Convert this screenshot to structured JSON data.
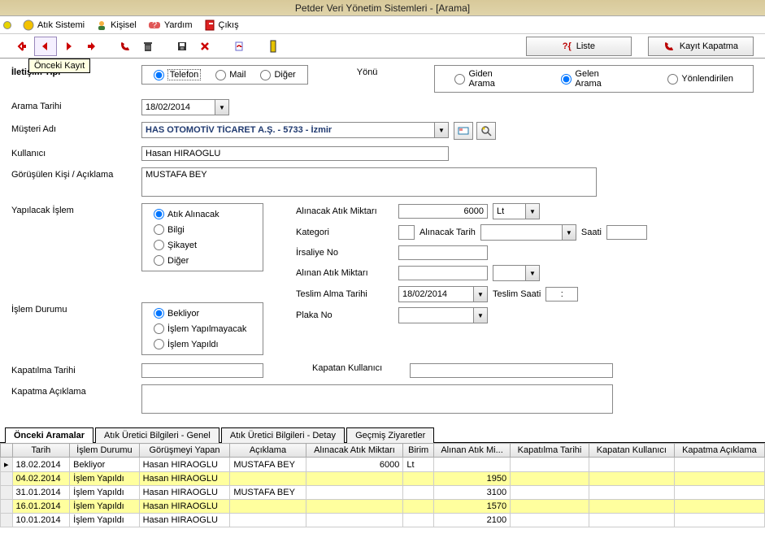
{
  "title": "Petder Veri Yönetim Sistemleri - [Arama]",
  "menu": {
    "atik": "Atık Sistemi",
    "kisisel": "Kişisel",
    "yardim": "Yardım",
    "cikis": "Çıkış"
  },
  "toolbar": {
    "tooltip_prev": "Önceki Kayıt",
    "btn_liste": "Liste",
    "btn_kapat": "Kayıt Kapatma"
  },
  "labels": {
    "iletisim_tipi": "İletişim Tipi",
    "yonu": "Yönü",
    "arama_tarihi": "Arama Tarihi",
    "musteri_adi": "Müşteri Adı",
    "kullanici": "Kullanıcı",
    "gorusulen": "Görüşülen Kişi  /  Açıklama",
    "yapilacak_islem": "Yapılacak İşlem",
    "islem_durumu": "İşlem Durumu",
    "kapatilma_tarihi": "Kapatılma Tarihi",
    "kapatan_kullanici": "Kapatan Kullanıcı",
    "kapatma_aciklama": "Kapatma Açıklama",
    "alinacak_miktar": "Alınacak Atık Miktarı",
    "kategori": "Kategori",
    "alinacak_tarih": "Alınacak Tarih",
    "saati": "Saati",
    "irsaliye": "İrsaliye No",
    "alinan_miktar": "Alınan Atık Miktarı",
    "teslim_tarih": "Teslim Alma Tarihi",
    "teslim_saat": "Teslim Saati",
    "plaka": "Plaka No"
  },
  "iletisim_options": {
    "telefon": "Telefon",
    "mail": "Mail",
    "diger": "Diğer"
  },
  "yonu_options": {
    "giden": "Giden Arama",
    "gelen": "Gelen Arama",
    "yon": "Yönlendirilen"
  },
  "yapilacak_options": {
    "atik": "Atık Alınacak",
    "bilgi": "Bilgi",
    "sikayet": "Şikayet",
    "diger": "Diğer"
  },
  "durum_options": {
    "bekliyor": "Bekliyor",
    "yapilmayacak": "İşlem Yapılmayacak",
    "yapildi": "İşlem Yapıldı"
  },
  "values": {
    "arama_tarihi": "18/02/2014",
    "musteri": "HAS OTOMOTİV TİCARET A.Ş. - 5733 - İzmir",
    "kullanici": "Hasan HIRAOGLU",
    "gorusulen": "MUSTAFA BEY",
    "alinacak_miktar": "6000",
    "birim": "Lt",
    "kategori": "",
    "alinacak_tarih": "",
    "alinacak_saat": "",
    "irsaliye": "",
    "alinan_miktar": "",
    "teslim_tarih": "18/02/2014",
    "teslim_saat": ":",
    "plaka": "",
    "kapatilma_tarihi": "",
    "kapatan_kullanici": "",
    "kapatma_aciklama": ""
  },
  "tabs": {
    "t1": "Önceki Aramalar",
    "t2": "Atık Üretici Bilgileri - Genel",
    "t3": "Atık Üretici Bilgileri - Detay",
    "t4": "Geçmiş Ziyaretler"
  },
  "grid": {
    "headers": {
      "tarih": "Tarih",
      "durum": "İşlem Durumu",
      "yapan": "Görüşmeyi Yapan",
      "aciklama": "Açıklama",
      "alinacak": "Alınacak Atık Miktarı",
      "birim": "Birim",
      "alinan": "Alınan Atık Mi...",
      "kaptar": "Kapatılma Tarihi",
      "kapkul": "Kapatan Kullanıcı",
      "kapacik": "Kapatma Açıklama"
    },
    "rows": [
      {
        "current": true,
        "hl": false,
        "tarih": "18.02.2014",
        "durum": "Bekliyor",
        "yapan": "Hasan HIRAOGLU",
        "aciklama": "MUSTAFA BEY",
        "alinacak": "6000",
        "birim": "Lt",
        "alinan": "",
        "kaptar": "",
        "kapkul": "",
        "kapacik": ""
      },
      {
        "current": false,
        "hl": true,
        "tarih": "04.02.2014",
        "durum": "İşlem Yapıldı",
        "yapan": "Hasan HIRAOGLU",
        "aciklama": "",
        "alinacak": "",
        "birim": "",
        "alinan": "1950",
        "kaptar": "",
        "kapkul": "",
        "kapacik": ""
      },
      {
        "current": false,
        "hl": false,
        "tarih": "31.01.2014",
        "durum": "İşlem Yapıldı",
        "yapan": "Hasan HIRAOGLU",
        "aciklama": "MUSTAFA BEY",
        "alinacak": "",
        "birim": "",
        "alinan": "3100",
        "kaptar": "",
        "kapkul": "",
        "kapacik": ""
      },
      {
        "current": false,
        "hl": true,
        "tarih": "16.01.2014",
        "durum": "İşlem Yapıldı",
        "yapan": "Hasan HIRAOGLU",
        "aciklama": "",
        "alinacak": "",
        "birim": "",
        "alinan": "1570",
        "kaptar": "",
        "kapkul": "",
        "kapacik": ""
      },
      {
        "current": false,
        "hl": false,
        "tarih": "10.01.2014",
        "durum": "İşlem Yapıldı",
        "yapan": "Hasan HIRAOGLU",
        "aciklama": "",
        "alinacak": "",
        "birim": "",
        "alinan": "2100",
        "kaptar": "",
        "kapkul": "",
        "kapacik": ""
      }
    ]
  }
}
